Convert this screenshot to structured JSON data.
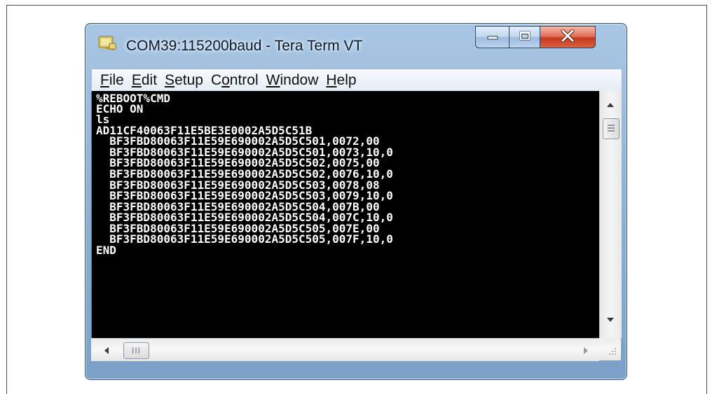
{
  "window": {
    "title": "COM39:115200baud - Tera Term VT",
    "icon": "tera-term-app-icon",
    "controls": [
      "minimize-icon",
      "maximize-icon",
      "close-icon"
    ]
  },
  "menu": [
    {
      "mnemonic": "F",
      "rest": "ile"
    },
    {
      "mnemonic": "E",
      "rest": "dit"
    },
    {
      "mnemonic": "S",
      "rest": "etup"
    },
    {
      "prefix": "C",
      "mnemonic": "o",
      "rest": "ntrol"
    },
    {
      "mnemonic": "W",
      "rest": "indow"
    },
    {
      "mnemonic": "H",
      "rest": "elp"
    }
  ],
  "terminal": {
    "lines": [
      "%REBOOT%CMD",
      "ECHO ON",
      "ls",
      "AD11CF40063F11E5BE3E0002A5D5C51B",
      "  BF3FBD80063F11E59E690002A5D5C501,0072,00",
      "  BF3FBD80063F11E59E690002A5D5C501,0073,10,0",
      "  BF3FBD80063F11E59E690002A5D5C502,0075,00",
      "  BF3FBD80063F11E59E690002A5D5C502,0076,10,0",
      "  BF3FBD80063F11E59E690002A5D5C503,0078,08",
      "  BF3FBD80063F11E59E690002A5D5C503,0079,10,0",
      "  BF3FBD80063F11E59E690002A5D5C504,007B,00",
      "  BF3FBD80063F11E59E690002A5D5C504,007C,10,0",
      "  BF3FBD80063F11E59E690002A5D5C505,007E,00",
      "  BF3FBD80063F11E59E690002A5D5C505,007F,10,0",
      "END"
    ]
  },
  "scrollbars": {
    "vertical": {
      "icons": [
        "arrow-up-icon",
        "arrow-down-icon"
      ]
    },
    "horizontal": {
      "thumb_glyph": "III",
      "icons": [
        "arrow-left-icon",
        "arrow-right-icon"
      ]
    }
  },
  "colors": {
    "terminal_bg": "#000000",
    "terminal_fg": "#ffffff",
    "close_button": "#c63a1e",
    "window_frame": "#8fb2d6"
  }
}
